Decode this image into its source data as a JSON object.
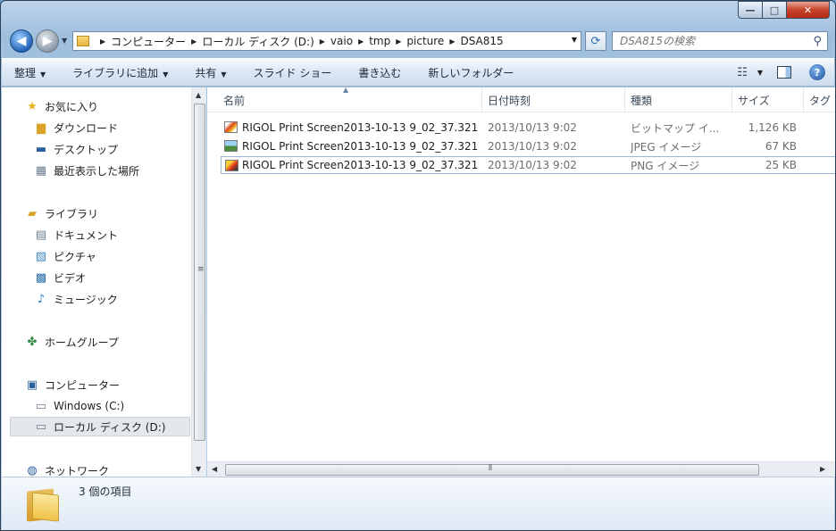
{
  "window": {
    "caption_buttons": {
      "minimize": "—",
      "maximize": "□",
      "close": "✕"
    }
  },
  "address_bar": {
    "crumbs": [
      "コンピューター",
      "ローカル ディスク (D:)",
      "vaio",
      "tmp",
      "picture",
      "DSA815"
    ]
  },
  "search": {
    "placeholder": "DSA815の検索"
  },
  "toolbar": {
    "organize": "整理",
    "add_to_library": "ライブラリに追加",
    "share": "共有",
    "slideshow": "スライド ショー",
    "burn": "書き込む",
    "new_folder": "新しいフォルダー",
    "help": "?"
  },
  "navigation": {
    "favorites": "お気に入り",
    "downloads": "ダウンロード",
    "desktop": "デスクトップ",
    "recent": "最近表示した場所",
    "libraries": "ライブラリ",
    "documents": "ドキュメント",
    "pictures": "ピクチャ",
    "videos": "ビデオ",
    "music": "ミュージック",
    "homegroup": "ホームグループ",
    "computer": "コンピューター",
    "drive_c": "Windows (C:)",
    "drive_d": "ローカル ディスク (D:)",
    "network": "ネットワーク"
  },
  "columns": {
    "name": "名前",
    "date": "日付時刻",
    "type": "種類",
    "size": "サイズ",
    "tags": "タグ"
  },
  "files": [
    {
      "name": "RIGOL Print Screen2013-10-13 9_02_37.321",
      "date": "2013/10/13 9:02",
      "type": "ビットマップ イ...",
      "size": "1,126 KB",
      "icon": "bitmap-icon"
    },
    {
      "name": "RIGOL Print Screen2013-10-13 9_02_37.321",
      "date": "2013/10/13 9:02",
      "type": "JPEG イメージ",
      "size": "67 KB",
      "icon": "jpeg-icon"
    },
    {
      "name": "RIGOL Print Screen2013-10-13 9_02_37.321",
      "date": "2013/10/13 9:02",
      "type": "PNG イメージ",
      "size": "25 KB",
      "icon": "png-icon"
    }
  ],
  "details_pane": {
    "item_count": "3 個の項目"
  },
  "colors": {
    "selection_border": "#9db9d8",
    "toolbar_gradient_top": "#f5f9fd",
    "frame": "#9fbfdf"
  }
}
